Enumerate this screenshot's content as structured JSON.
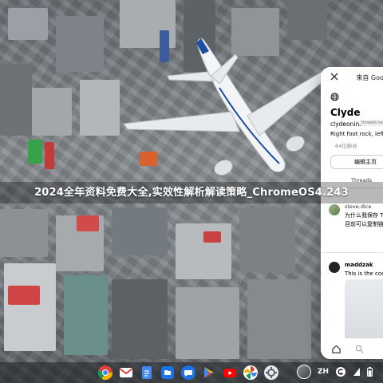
{
  "headline": "2024全年资料免费大全,实效性解析解读策略_ChromeOS4.243",
  "threads_panel": {
    "top_link": "来自 Goog",
    "name": "Clyde",
    "handle": "clydeonins",
    "badge": "threads.net",
    "bio": "Right foot rock, left har",
    "followers": "64位粉丝",
    "edit_button": "编辑主页",
    "tab_label": "Threads",
    "post1": {
      "user": "steve.dice",
      "line1": "为什么我保存 Thre",
      "line2": "目前可以复制链接"
    },
    "post2": {
      "user": "maddzak",
      "text": "This is the coole"
    }
  },
  "shelf": {
    "apps": [
      "chrome",
      "gmail",
      "docs",
      "files",
      "messages",
      "play-store",
      "youtube",
      "photos",
      "settings"
    ],
    "ime_label": "ZH",
    "battery_level": 0.8
  },
  "colors": {
    "chrome_red": "#db4437",
    "chrome_yellow": "#f4b400",
    "chrome_green": "#0f9d58",
    "chrome_blue": "#4285f4",
    "plane_blue": "#1c4fa0"
  }
}
